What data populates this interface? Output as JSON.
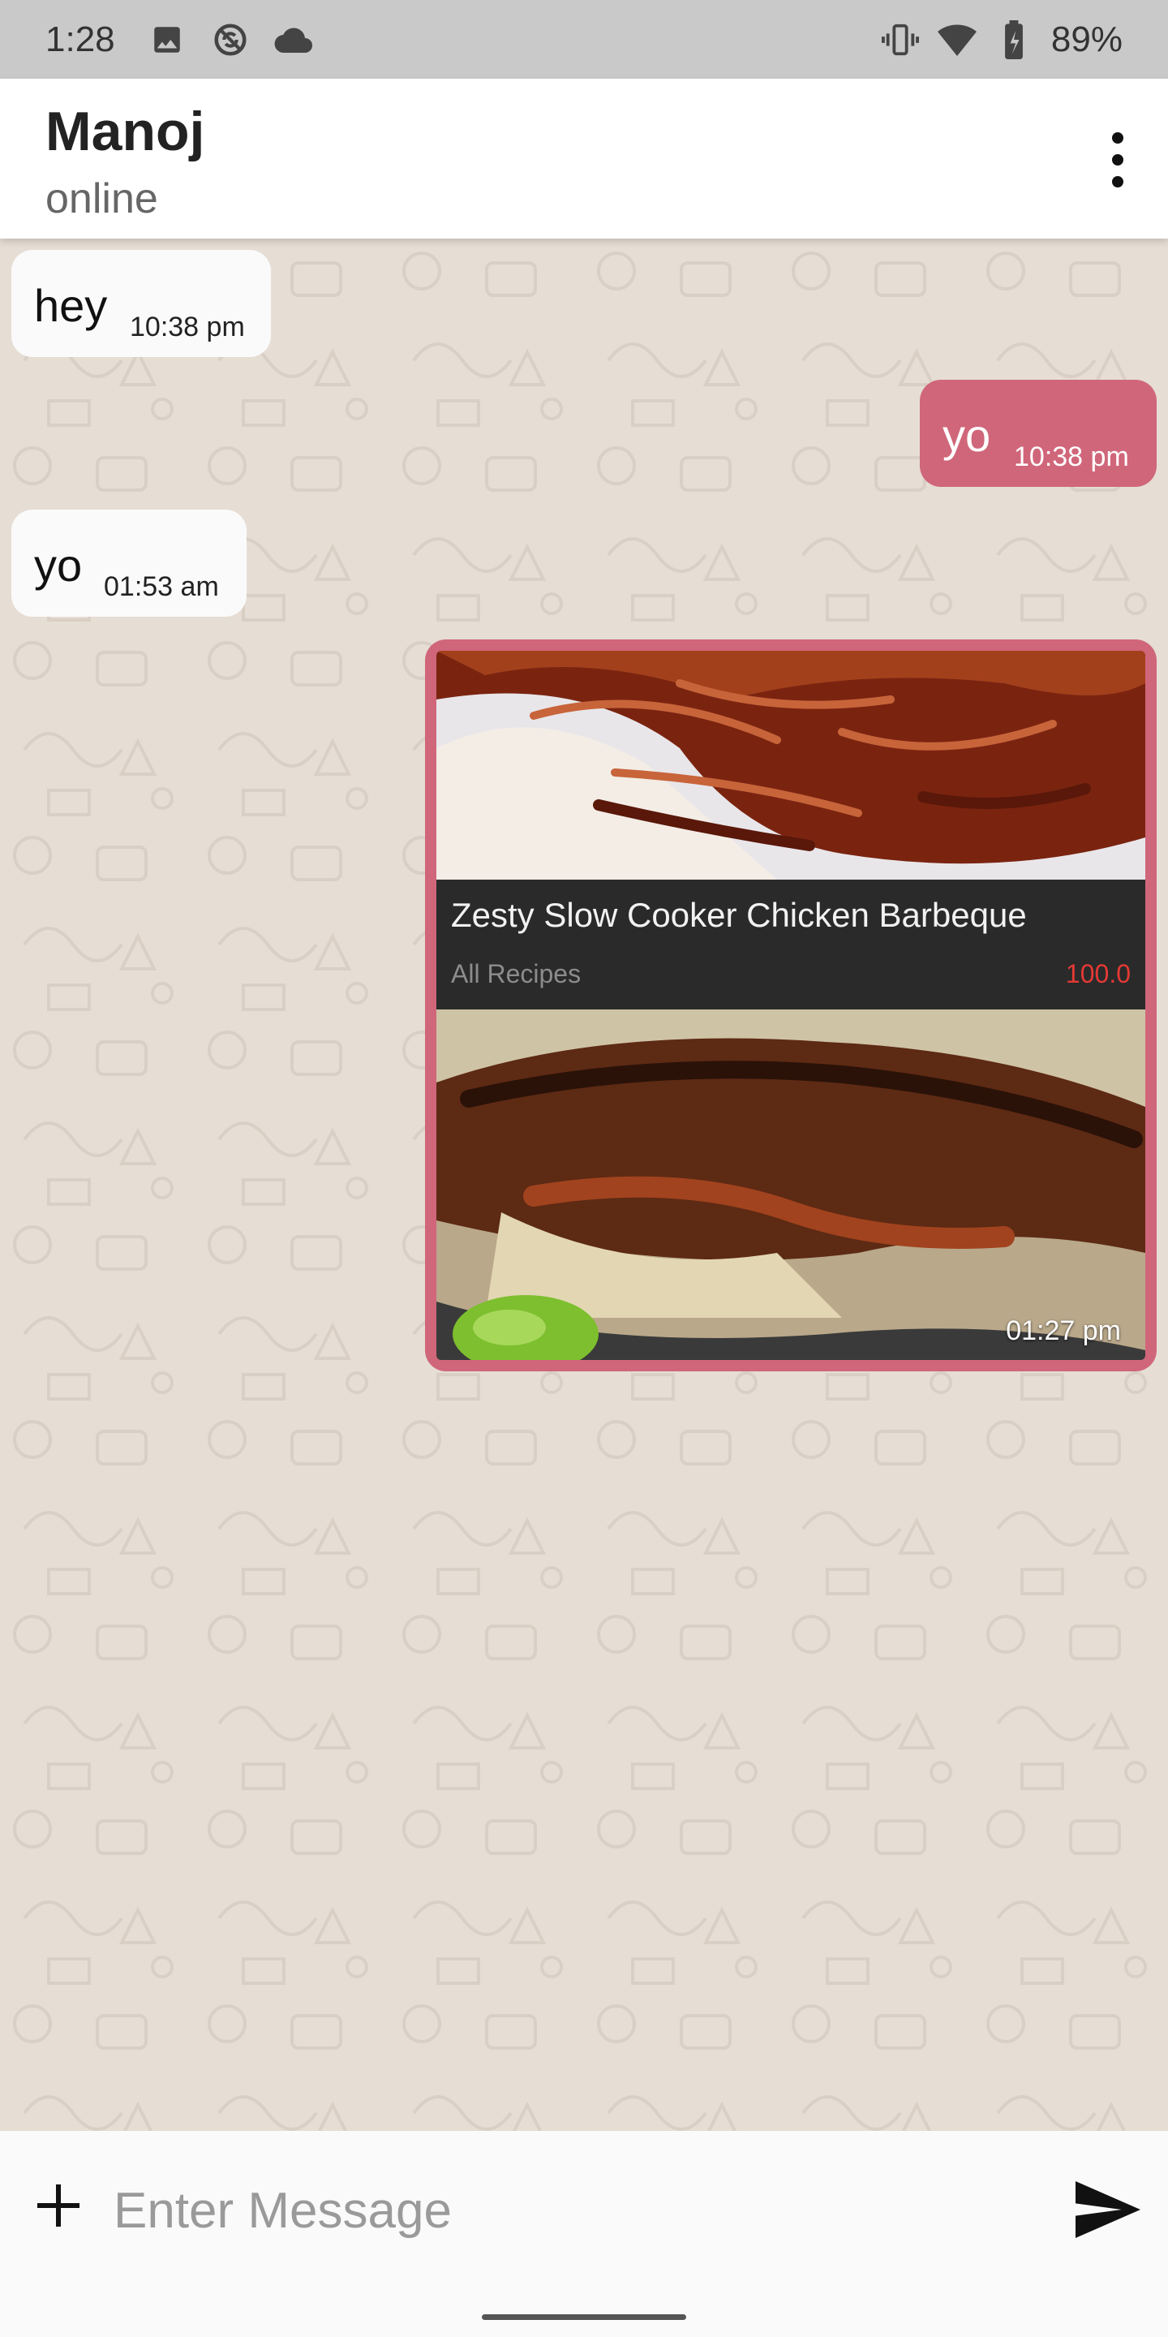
{
  "status_bar": {
    "time": "1:28",
    "battery": "89%",
    "icons": [
      "image-icon",
      "sync-icon",
      "cloud-icon",
      "vibrate-icon",
      "wifi-icon",
      "battery-icon"
    ]
  },
  "header": {
    "contact_name": "Manoj",
    "contact_status": "online",
    "menu_icon": "more-vert-icon"
  },
  "messages": [
    {
      "direction": "incoming",
      "text": "hey",
      "time": "10:38 pm"
    },
    {
      "direction": "outgoing",
      "text": "yo",
      "time": "10:38 pm"
    },
    {
      "direction": "incoming",
      "text": "yo",
      "time": "01:53 am"
    }
  ],
  "shared_card": {
    "title": "Zesty Slow Cooker Chicken Barbeque",
    "source": "All Recipes",
    "price": "100.0",
    "time": "01:27 pm"
  },
  "input": {
    "placeholder": "Enter Message",
    "value": "",
    "add_icon": "plus-icon",
    "send_icon": "send-icon"
  },
  "colors": {
    "outgoing_bubble": "#d0667a",
    "incoming_bubble": "#fafafa",
    "wallpaper": "#e6ddd4",
    "price": "#e53935"
  }
}
